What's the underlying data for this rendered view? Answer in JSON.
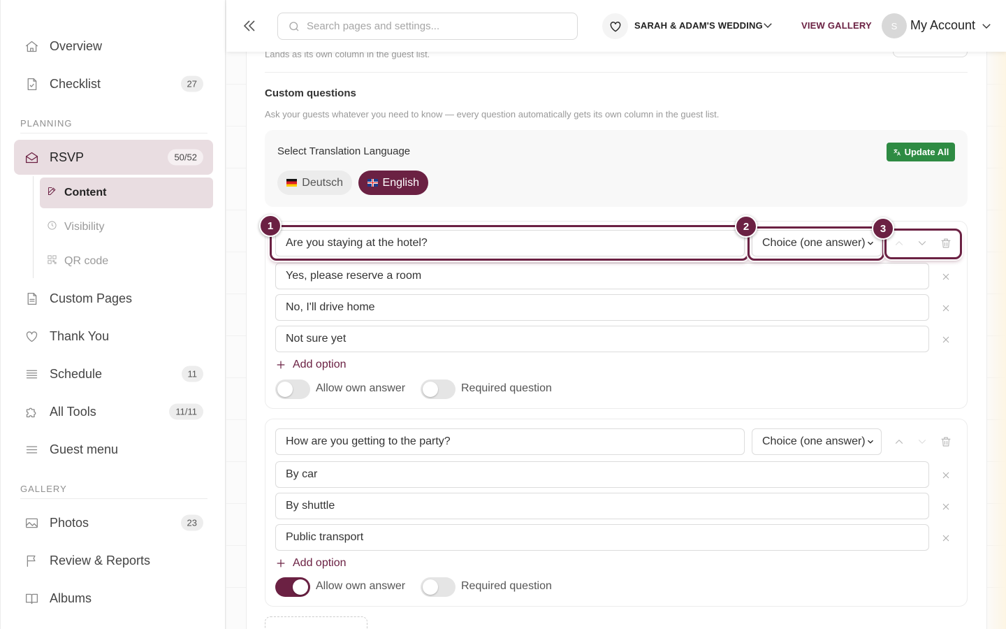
{
  "sidebar": {
    "items": [
      {
        "label": "Overview",
        "icon": "home-icon"
      },
      {
        "label": "Checklist",
        "icon": "checklist-icon",
        "badge": "27"
      },
      {
        "label": "RSVP",
        "icon": "envelope-icon",
        "badge": "50/52"
      },
      {
        "label": "Custom Pages",
        "icon": "page-icon"
      },
      {
        "label": "Thank You",
        "icon": "heart-icon"
      },
      {
        "label": "Schedule",
        "icon": "list-icon",
        "badge": "11"
      },
      {
        "label": "All Tools",
        "icon": "puzzle-icon",
        "badge": "11/11"
      },
      {
        "label": "Guest menu",
        "icon": "menu-icon"
      },
      {
        "label": "Photos",
        "icon": "image-icon",
        "badge": "23"
      },
      {
        "label": "Review & Reports",
        "icon": "flag-icon"
      },
      {
        "label": "Albums",
        "icon": "book-icon"
      }
    ],
    "sections": {
      "planning": "PLANNING",
      "gallery": "GALLERY"
    },
    "rsvp_sub": [
      {
        "label": "Content",
        "icon": "edit-icon"
      },
      {
        "label": "Visibility",
        "icon": "clock-icon"
      },
      {
        "label": "QR code",
        "icon": "qr-icon"
      }
    ]
  },
  "topbar": {
    "search_placeholder": "Search pages and settings...",
    "event_name": "SARAH & ADAM'S WEDDING",
    "view_gallery": "VIEW GALLERY",
    "avatar_initial": "S",
    "account": "My Account"
  },
  "content": {
    "cut_text": "Lands as its own column in the guest list.",
    "custom_questions_title": "Custom questions",
    "custom_questions_desc": "Ask your guests whatever you need to know — every question automatically gets its own column in the guest list.",
    "translation": {
      "title": "Select Translation Language",
      "update_all": "Update All",
      "languages": [
        "Deutsch",
        "English"
      ],
      "selected": "English"
    },
    "questions": [
      {
        "question": "Are you staying at the hotel?",
        "type": "Choice (one answer)",
        "options": [
          "Yes, please reserve a room",
          "No, I'll drive home",
          "Not sure yet"
        ],
        "add_option": "Add option",
        "allow_own_answer": false,
        "required": false
      },
      {
        "question": "How are you getting to the party?",
        "type": "Choice (one answer)",
        "options": [
          "By car",
          "By shuttle",
          "Public transport"
        ],
        "add_option": "Add option",
        "allow_own_answer": true,
        "required": false
      }
    ],
    "toggle_labels": {
      "allow_own": "Allow own answer",
      "required": "Required question"
    },
    "markers": [
      "1",
      "2",
      "3"
    ]
  },
  "colors": {
    "accent": "#6b2143",
    "update_green": "#2e8b43",
    "active_bg": "#e9dde1"
  }
}
